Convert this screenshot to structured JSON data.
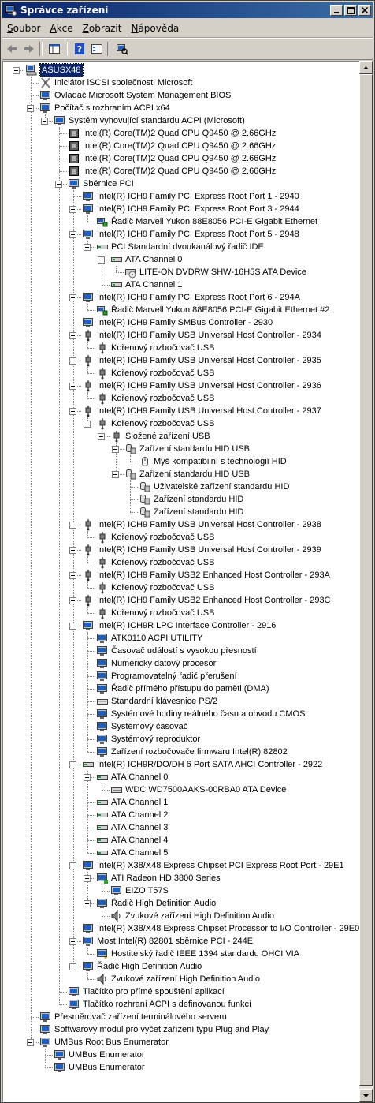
{
  "window": {
    "title": "Správce zařízení"
  },
  "menu": [
    {
      "pre": "",
      "key": "S",
      "post": "oubor"
    },
    {
      "pre": "",
      "key": "A",
      "post": "kce"
    },
    {
      "pre": "",
      "key": "Z",
      "post": "obrazit"
    },
    {
      "pre": "",
      "key": "N",
      "post": "ápověda"
    }
  ],
  "toolbar": [
    {
      "icon": "back-arrow-icon"
    },
    {
      "icon": "forward-arrow-icon"
    },
    {
      "sep": true
    },
    {
      "icon": "console-tree-icon"
    },
    {
      "sep": true
    },
    {
      "icon": "help-icon"
    },
    {
      "icon": "properties-icon"
    },
    {
      "sep": true
    },
    {
      "icon": "scan-hardware-icon"
    }
  ],
  "tree": [
    {
      "d": 0,
      "t": "ASUSX48",
      "i": "computer",
      "e": true,
      "sel": true
    },
    {
      "d": 1,
      "t": "Iniciátor iSCSI společnosti Microsoft",
      "i": "iscsi"
    },
    {
      "d": 1,
      "t": "Ovladač Microsoft System Management BIOS",
      "i": "monitor"
    },
    {
      "d": 1,
      "t": "Počítač s rozhraním ACPI x64",
      "i": "monitor",
      "e": true
    },
    {
      "d": 2,
      "t": "Systém vyhovující standardu ACPI (Microsoft)",
      "i": "monitor",
      "e": true
    },
    {
      "d": 3,
      "t": "Intel(R) Core(TM)2 Quad  CPU   Q9450  @ 2.66GHz",
      "i": "cpu"
    },
    {
      "d": 3,
      "t": "Intel(R) Core(TM)2 Quad  CPU   Q9450  @ 2.66GHz",
      "i": "cpu"
    },
    {
      "d": 3,
      "t": "Intel(R) Core(TM)2 Quad  CPU   Q9450  @ 2.66GHz",
      "i": "cpu"
    },
    {
      "d": 3,
      "t": "Intel(R) Core(TM)2 Quad  CPU   Q9450  @ 2.66GHz",
      "i": "cpu"
    },
    {
      "d": 3,
      "t": "Sběrnice PCI",
      "i": "monitor",
      "e": true
    },
    {
      "d": 4,
      "t": "Intel(R) ICH9 Family PCI Express Root Port 1 - 2940",
      "i": "monitor"
    },
    {
      "d": 4,
      "t": "Intel(R) ICH9 Family PCI Express Root Port 3 - 2944",
      "i": "monitor",
      "e": true
    },
    {
      "d": 5,
      "t": "Řadič Marvell Yukon 88E8056 PCI-E Gigabit Ethernet",
      "i": "network"
    },
    {
      "d": 4,
      "t": "Intel(R) ICH9 Family PCI Express Root Port 5 - 2948",
      "i": "monitor",
      "e": true
    },
    {
      "d": 5,
      "t": "PCI Standardní dvoukanálový řadič IDE",
      "i": "disk",
      "e": true
    },
    {
      "d": 6,
      "t": "ATA Channel 0",
      "i": "disk",
      "e": true
    },
    {
      "d": 7,
      "t": "LITE-ON DVDRW SHW-16H5S ATA Device",
      "i": "cdrom"
    },
    {
      "d": 6,
      "t": "ATA Channel 1",
      "i": "disk"
    },
    {
      "d": 4,
      "t": "Intel(R) ICH9 Family PCI Express Root Port 6 - 294A",
      "i": "monitor",
      "e": true
    },
    {
      "d": 5,
      "t": "Řadič Marvell Yukon 88E8056 PCI-E Gigabit Ethernet #2",
      "i": "network"
    },
    {
      "d": 4,
      "t": "Intel(R) ICH9 Family SMBus Controller - 2930",
      "i": "monitor"
    },
    {
      "d": 4,
      "t": "Intel(R) ICH9 Family USB Universal Host Controller - 2934",
      "i": "usb",
      "e": true
    },
    {
      "d": 5,
      "t": "Kořenový rozbočovač USB",
      "i": "usb"
    },
    {
      "d": 4,
      "t": "Intel(R) ICH9 Family USB Universal Host Controller - 2935",
      "i": "usb",
      "e": true
    },
    {
      "d": 5,
      "t": "Kořenový rozbočovač USB",
      "i": "usb"
    },
    {
      "d": 4,
      "t": "Intel(R) ICH9 Family USB Universal Host Controller - 2936",
      "i": "usb",
      "e": true
    },
    {
      "d": 5,
      "t": "Kořenový rozbočovač USB",
      "i": "usb"
    },
    {
      "d": 4,
      "t": "Intel(R) ICH9 Family USB Universal Host Controller - 2937",
      "i": "usb",
      "e": true
    },
    {
      "d": 5,
      "t": "Kořenový rozbočovač USB",
      "i": "usb",
      "e": true
    },
    {
      "d": 6,
      "t": "Složené zařízení USB",
      "i": "usb",
      "e": true
    },
    {
      "d": 7,
      "t": "Zařízení standardu HID USB",
      "i": "hid",
      "e": true
    },
    {
      "d": 8,
      "t": "Myš kompatibilní s technologií HID",
      "i": "mouse"
    },
    {
      "d": 7,
      "t": "Zařízení standardu HID USB",
      "i": "hid",
      "e": true
    },
    {
      "d": 8,
      "t": "Uživatelské zařízení standardu HID",
      "i": "hid"
    },
    {
      "d": 8,
      "t": "Zařízení standardu HID",
      "i": "hid"
    },
    {
      "d": 8,
      "t": "Zařízení standardu HID",
      "i": "hid"
    },
    {
      "d": 4,
      "t": "Intel(R) ICH9 Family USB Universal Host Controller - 2938",
      "i": "usb",
      "e": true
    },
    {
      "d": 5,
      "t": "Kořenový rozbočovač USB",
      "i": "usb"
    },
    {
      "d": 4,
      "t": "Intel(R) ICH9 Family USB Universal Host Controller - 2939",
      "i": "usb",
      "e": true
    },
    {
      "d": 5,
      "t": "Kořenový rozbočovač USB",
      "i": "usb"
    },
    {
      "d": 4,
      "t": "Intel(R) ICH9 Family USB2 Enhanced Host Controller - 293A",
      "i": "usb",
      "e": true
    },
    {
      "d": 5,
      "t": "Kořenový rozbočovač USB",
      "i": "usb"
    },
    {
      "d": 4,
      "t": "Intel(R) ICH9 Family USB2 Enhanced Host Controller - 293C",
      "i": "usb",
      "e": true
    },
    {
      "d": 5,
      "t": "Kořenový rozbočovač USB",
      "i": "usb"
    },
    {
      "d": 4,
      "t": "Intel(R) ICH9R LPC Interface Controller - 2916",
      "i": "monitor",
      "e": true
    },
    {
      "d": 5,
      "t": "ATK0110 ACPI UTILITY",
      "i": "monitor"
    },
    {
      "d": 5,
      "t": "Časovač událostí s vysokou přesností",
      "i": "monitor"
    },
    {
      "d": 5,
      "t": "Numerický datový procesor",
      "i": "monitor"
    },
    {
      "d": 5,
      "t": "Programovatelný řadič přerušení",
      "i": "monitor"
    },
    {
      "d": 5,
      "t": "Řadič přímého přístupu do paměti (DMA)",
      "i": "monitor"
    },
    {
      "d": 5,
      "t": "Standardní klávesnice PS/2",
      "i": "keyboard"
    },
    {
      "d": 5,
      "t": "Systémové hodiny reálného času a obvodu CMOS",
      "i": "monitor"
    },
    {
      "d": 5,
      "t": "Systémový časovač",
      "i": "monitor"
    },
    {
      "d": 5,
      "t": "Systémový reproduktor",
      "i": "monitor"
    },
    {
      "d": 5,
      "t": "Zařízení rozbočovače firmwaru Intel(R) 82802",
      "i": "monitor"
    },
    {
      "d": 4,
      "t": "Intel(R) ICH9R/DO/DH 6 Port SATA AHCI Controller - 2922",
      "i": "disk",
      "e": true
    },
    {
      "d": 5,
      "t": "ATA Channel 0",
      "i": "disk",
      "e": true
    },
    {
      "d": 6,
      "t": "WDC WD7500AAKS-00RBA0 ATA Device",
      "i": "harddisk"
    },
    {
      "d": 5,
      "t": "ATA Channel 1",
      "i": "disk"
    },
    {
      "d": 5,
      "t": "ATA Channel 2",
      "i": "disk"
    },
    {
      "d": 5,
      "t": "ATA Channel 3",
      "i": "disk"
    },
    {
      "d": 5,
      "t": "ATA Channel 4",
      "i": "disk"
    },
    {
      "d": 5,
      "t": "ATA Channel 5",
      "i": "disk"
    },
    {
      "d": 4,
      "t": "Intel(R) X38/X48 Express Chipset PCI Express Root Port - 29E1",
      "i": "monitor",
      "e": true
    },
    {
      "d": 5,
      "t": "ATI Radeon HD 3800 Series",
      "i": "display",
      "e": true
    },
    {
      "d": 6,
      "t": "EIZO T57S",
      "i": "monitor"
    },
    {
      "d": 5,
      "t": "Řadič High Definition Audio",
      "i": "monitor",
      "e": true
    },
    {
      "d": 6,
      "t": "Zvukové zařízení High Definition Audio",
      "i": "sound"
    },
    {
      "d": 4,
      "t": "Intel(R) X38/X48 Express Chipset Processor to I/O Controller - 29E0",
      "i": "monitor"
    },
    {
      "d": 4,
      "t": "Most Intel(R) 82801 sběrnice PCI - 244E",
      "i": "monitor",
      "e": true
    },
    {
      "d": 5,
      "t": "Hostitelský řadič IEEE 1394 standardu OHCI VIA",
      "i": "firewire"
    },
    {
      "d": 4,
      "t": "Řadič High Definition Audio",
      "i": "monitor",
      "e": true
    },
    {
      "d": 5,
      "t": "Zvukové zařízení High Definition Audio",
      "i": "sound"
    },
    {
      "d": 3,
      "t": "Tlačítko pro přímé spouštění aplikací",
      "i": "monitor"
    },
    {
      "d": 3,
      "t": "Tlačítko rozhraní ACPI s definovanou funkcí",
      "i": "monitor"
    },
    {
      "d": 1,
      "t": "Přesměrovač zařízení terminálového serveru",
      "i": "monitor"
    },
    {
      "d": 1,
      "t": "Softwarový modul pro výčet zařízení typu Plug and Play",
      "i": "monitor"
    },
    {
      "d": 1,
      "t": "UMBus Root Bus Enumerator",
      "i": "monitor",
      "e": true
    },
    {
      "d": 2,
      "t": "UMBus Enumerator",
      "i": "monitor"
    },
    {
      "d": 2,
      "t": "UMBus Enumerator",
      "i": "monitor"
    }
  ]
}
